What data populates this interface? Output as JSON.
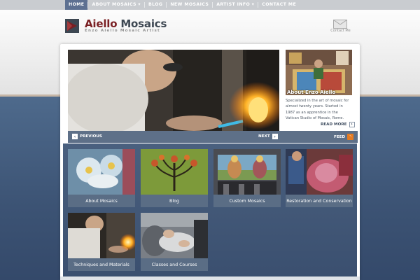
{
  "nav": {
    "items": [
      {
        "label": "HOME",
        "active": true
      },
      {
        "label": "ABOUT MOSAICS ▾",
        "active": false
      },
      {
        "label": "BLOG",
        "active": false
      },
      {
        "label": "NEW MOSAICS",
        "active": false
      },
      {
        "label": "ARTIST INFO ▾",
        "active": false
      },
      {
        "label": "CONTACT ME",
        "active": false
      }
    ]
  },
  "header": {
    "title_part1": "Aiello",
    "title_part2": " Mosaics",
    "subtitle": "Enzo Aiello  Mosaic Artist",
    "contact_label": "Contact Me"
  },
  "slider": {
    "caption": "About Enzo Aiello",
    "description": "Specialized in the art of mosaic for almost twenty years. Started in 1987 as an apprentice in the Vatican Studio of Mosaic, Rome.",
    "read_more": "READ MORE",
    "previous": "PREVIOUS",
    "next": "NEXT",
    "feed": "FEED"
  },
  "tiles": [
    {
      "label": "About Mosaics"
    },
    {
      "label": "Blog"
    },
    {
      "label": "Custom Mosaics"
    },
    {
      "label": "Restoration and Conservation"
    },
    {
      "label": "Techniques and Materials"
    },
    {
      "label": "Classes and Courses"
    }
  ],
  "colors": {
    "nav_bg": "#c9ccd0",
    "nav_active": "#5d7091",
    "brand_red": "#7a1f23",
    "page_blue": "#3f5676",
    "bar_blue": "#5e7088",
    "rss_orange": "#e57b22"
  }
}
